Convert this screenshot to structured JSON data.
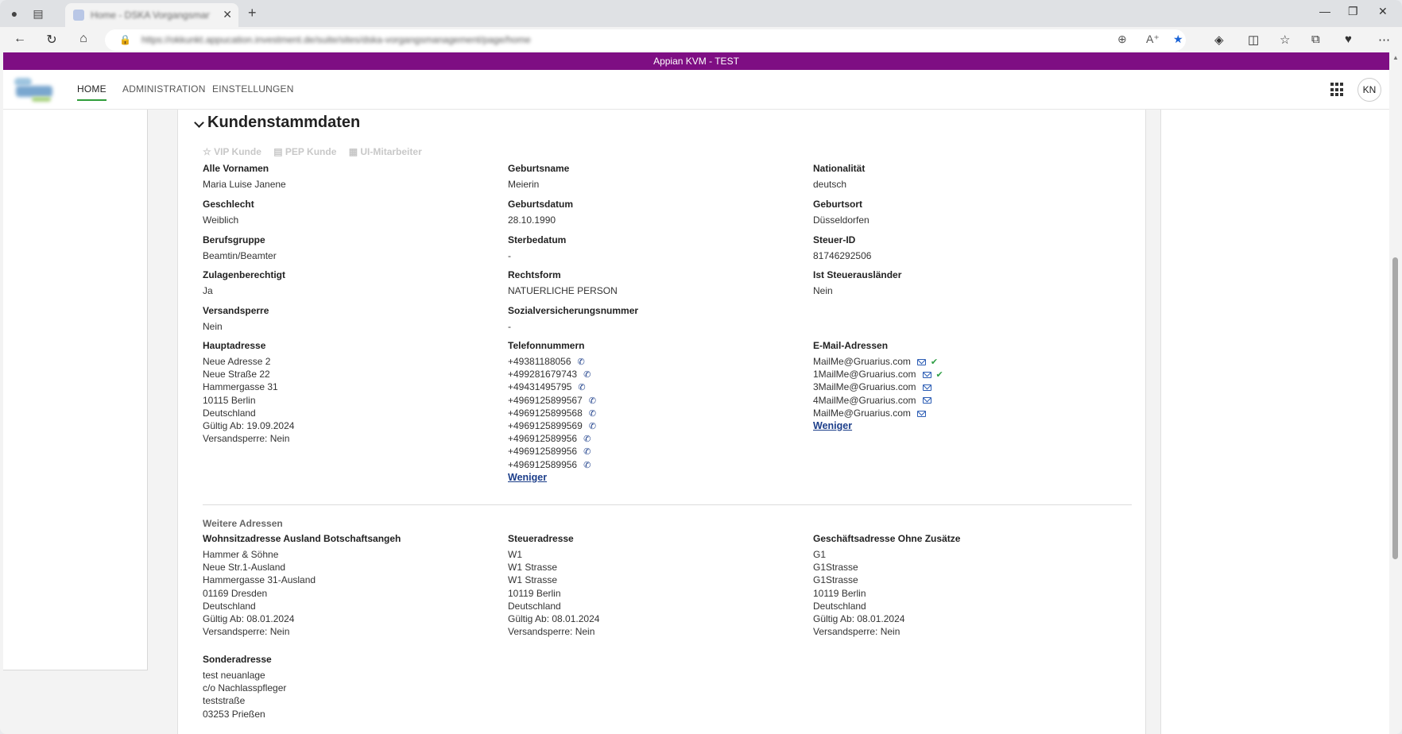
{
  "browser": {
    "tab_title": "Home - DSKA Vorgangsmanagement",
    "url": "https://okkunkt.appucation.investment.de/suite/sites/dska-vorgangsmanagement/page/home",
    "close_glyph": "✕",
    "newtab_glyph": "+"
  },
  "app": {
    "env_title": "Appian KVM - TEST",
    "nav": [
      "HOME",
      "ADMINISTRATION",
      "EINSTELLUNGEN"
    ],
    "user_initials": "KN"
  },
  "section": {
    "title": "Kundenstammdaten",
    "flags": [
      "VIP Kunde",
      "PEP Kunde",
      "UI-Mitarbeiter"
    ]
  },
  "fields": {
    "vornamen": {
      "label": "Alle Vornamen",
      "value": "Maria Luise  Janene"
    },
    "geburtsname": {
      "label": "Geburtsname",
      "value": "Meierin"
    },
    "nationalitaet": {
      "label": "Nationalität",
      "value": "deutsch"
    },
    "geschlecht": {
      "label": "Geschlecht",
      "value": "Weiblich"
    },
    "geburtsdatum": {
      "label": "Geburtsdatum",
      "value": "28.10.1990"
    },
    "geburtsort": {
      "label": "Geburtsort",
      "value": "Düsseldorfen"
    },
    "berufsgruppe": {
      "label": "Berufsgruppe",
      "value": "Beamtin/Beamter"
    },
    "sterbedatum": {
      "label": "Sterbedatum",
      "value": "-"
    },
    "steuerid": {
      "label": "Steuer-ID",
      "value": "81746292506"
    },
    "zulagen": {
      "label": "Zulagenberechtigt",
      "value": "Ja"
    },
    "rechtsform": {
      "label": "Rechtsform",
      "value": "NATUERLICHE PERSON"
    },
    "steuerauslaender": {
      "label": "Ist Steuerausländer",
      "value": "Nein"
    },
    "versandsperre": {
      "label": "Versandsperre",
      "value": "Nein"
    },
    "sozialvers": {
      "label": "Sozialversicherungsnummer",
      "value": "-"
    }
  },
  "hauptadresse": {
    "label": "Hauptadresse",
    "lines": [
      "Neue Adresse 2",
      "Neue Straße 22",
      "Hammergasse 31",
      "10115 Berlin",
      "Deutschland"
    ],
    "gueltig": "Gültig Ab: 19.09.2024",
    "sperre": "Versandsperre: Nein"
  },
  "telefon": {
    "label": "Telefonnummern",
    "numbers": [
      "+49381188056",
      "+499281679743",
      "+49431495795",
      "+4969125899567",
      "+4969125899568",
      "+4969125899569",
      "+496912589956",
      "+496912589956",
      "+496912589956"
    ],
    "less": "Weniger"
  },
  "email": {
    "label": "E-Mail-Adressen",
    "addresses": [
      "MailMe@Gruarius.com",
      "1MailMe@Gruarius.com",
      "3MailMe@Gruarius.com",
      "4MailMe@Gruarius.com",
      "MailMe@Gruarius.com"
    ],
    "less": "Weniger"
  },
  "weitere": {
    "heading": "Weitere Adressen",
    "wohnsitz": {
      "label": "Wohnsitzadresse Ausland Botschaftsangeh",
      "lines": [
        "Hammer & Söhne",
        "Neue Str.1-Ausland",
        "Hammergasse 31-Ausland",
        "01169 Dresden",
        "Deutschland"
      ],
      "gueltig": "Gültig Ab: 08.01.2024",
      "sperre": "Versandsperre: Nein"
    },
    "steuer": {
      "label": "Steueradresse",
      "lines": [
        "W1",
        "W1 Strasse",
        "W1 Strasse",
        "10119 Berlin",
        "Deutschland"
      ],
      "gueltig": "Gültig Ab: 08.01.2024",
      "sperre": "Versandsperre: Nein"
    },
    "geschaeft": {
      "label": "Geschäftsadresse Ohne Zusätze",
      "lines": [
        "G1",
        "G1Strasse",
        "G1Strasse",
        "10119 Berlin",
        "Deutschland"
      ],
      "gueltig": "Gültig Ab: 08.01.2024",
      "sperre": "Versandsperre: Nein"
    },
    "sonder": {
      "label": "Sonderadresse",
      "lines": [
        "test neuanlage",
        "c/o Nachlasspfleger",
        "teststraße",
        "03253 Prießen"
      ]
    }
  }
}
